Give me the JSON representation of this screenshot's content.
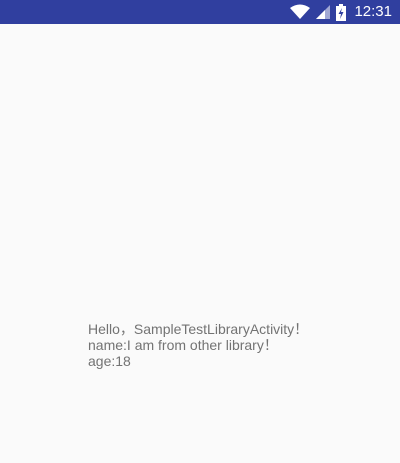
{
  "status_bar": {
    "time": "12:31",
    "icons": [
      "wifi-icon",
      "cellular-signal-icon",
      "battery-charging-icon"
    ],
    "background": "#303f9f"
  },
  "content": {
    "lines": [
      "Hello，SampleTestLibraryActivity！",
      "name:I am from other library！",
      "age:18"
    ],
    "text_color": "#737373",
    "background": "#fafafa"
  }
}
